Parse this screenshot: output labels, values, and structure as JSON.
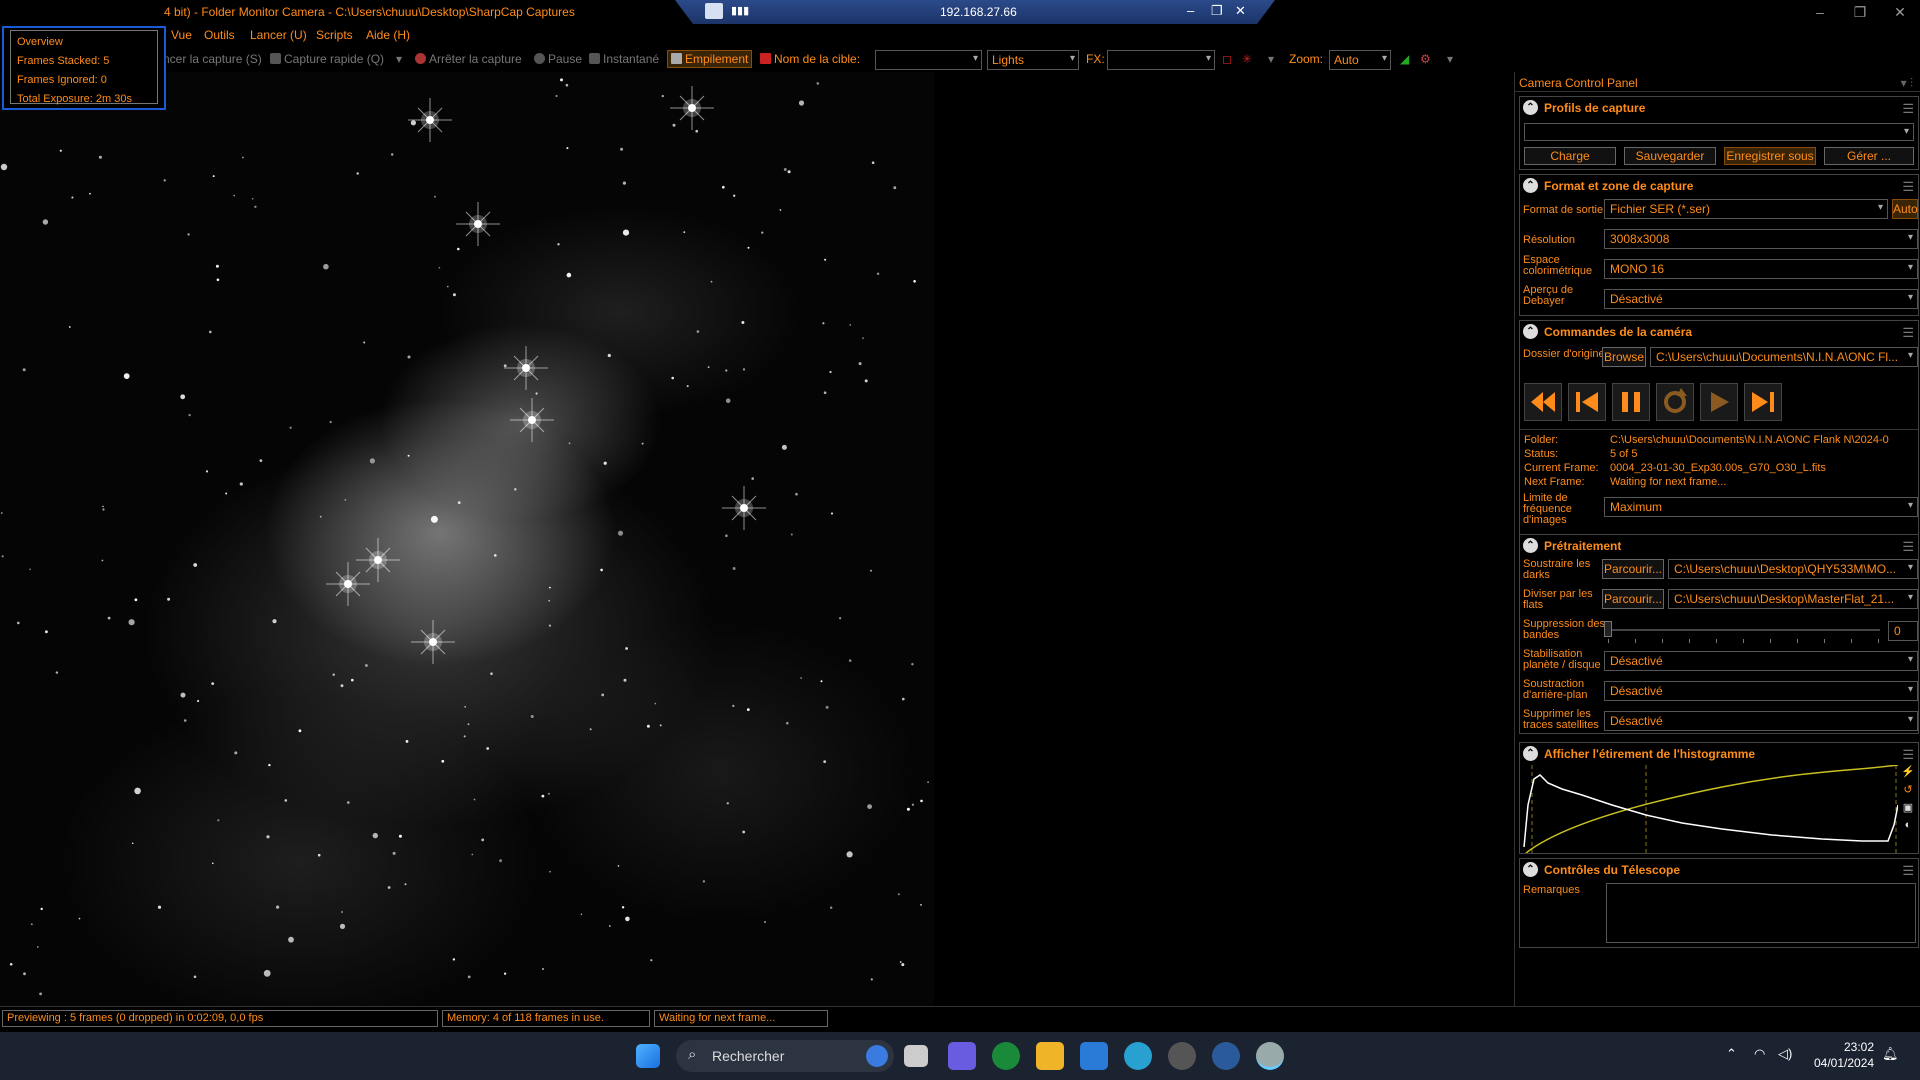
{
  "window": {
    "title": "4 bit) - Folder Monitor Camera - C:\\Users\\chuuu\\Desktop\\SharpCap Captures",
    "remote_ip": "192.168.27.66"
  },
  "menu": [
    "Vue",
    "Outils",
    "Lancer (U)",
    "Scripts",
    "Aide (H)"
  ],
  "toolbar": {
    "start_capture": "ncer la capture (S)",
    "quick_capture": "Capture rapide (Q)",
    "stop_capture": "Arrêter la capture",
    "pause": "Pause",
    "snapshot": "Instantané",
    "stacking": "Empilement",
    "target_name_label": "Nom de la cible:",
    "target_name_value": "",
    "frame_type": "Lights",
    "fx_label": "FX:",
    "fx_value": "",
    "zoom_label": "Zoom:",
    "zoom_value": "Auto"
  },
  "overview": {
    "title": "Overview",
    "frames_stacked": "Frames Stacked: 5",
    "frames_ignored": "Frames Ignored: 0",
    "total_exposure": "Total Exposure:   2m 30s"
  },
  "panel": {
    "title": "Camera Control Panel",
    "profiles": {
      "title": "Profils de capture",
      "selected": "",
      "load": "Charge",
      "save": "Sauvegarder",
      "save_as": "Enregistrer sous",
      "manage": "Gérer ..."
    },
    "format": {
      "title": "Format et zone de capture",
      "output_label": "Format de sortie",
      "output_value": "Fichier SER (*.ser)",
      "auto": "Auto",
      "resolution_label": "Résolution",
      "resolution_value": "3008x3008",
      "colorspace_label": "Espace colorimétrique",
      "colorspace_value": "MONO 16",
      "debayer_label": "Aperçu de Debayer",
      "debayer_value": "Désactivé"
    },
    "camera": {
      "title": "Commandes de la caméra",
      "source_label": "Dossier d'origine",
      "browse": "Browse",
      "source_value": "C:\\Users\\chuuu\\Documents\\N.I.N.A\\ONC Fl...",
      "folder_label": "Folder:",
      "folder_value": "C:\\Users\\chuuu\\Documents\\N.I.N.A\\ONC Flank N\\2024-0",
      "status_label": "Status:",
      "status_value": "5 of 5",
      "current_label": "Current Frame:",
      "current_value": "0004_23-01-30_Exp30.00s_G70_O30_L.fits",
      "next_label": "Next Frame:",
      "next_value": "Waiting for next frame...",
      "rate_label": "Limite de fréquence d'images",
      "rate_value": "Maximum"
    },
    "preprocessing": {
      "title": "Prétraitement",
      "darks_label": "Soustraire les darks",
      "darks_browse": "Parcourir...",
      "darks_value": "C:\\Users\\chuuu\\Desktop\\QHY533M\\MO...",
      "flats_label": "Diviser par les flats",
      "flats_browse": "Parcourir...",
      "flats_value": "C:\\Users\\chuuu\\Desktop\\MasterFlat_21...",
      "banding_label": "Suppression des bandes",
      "banding_value": "0",
      "stabilization_label": "Stabilisation planète / disque",
      "stabilization_value": "Désactivé",
      "background_label": "Soustraction d'arrière-plan",
      "background_value": "Désactivé",
      "satellite_label": "Supprimer les traces satellites",
      "satellite_value": "Désactivé"
    },
    "histogram": {
      "title": "Afficher l'étirement de l'histogramme"
    },
    "telescope": {
      "title": "Contrôles du Télescope",
      "notes_label": "Remarques",
      "notes_value": ""
    }
  },
  "status": {
    "previewing": "Previewing : 5 frames (0 dropped) in 0:02:09, 0,0 fps",
    "memory": "Memory: 4 of 118 frames in use.",
    "waiting": "Waiting for next frame..."
  },
  "taskbar": {
    "search": "Rechercher",
    "time": "23:02",
    "date": "04/01/2024"
  },
  "colors": {
    "accent": "#ff8c1a",
    "taskbar": "#1b2230",
    "remote_bar": "#2b4a8a"
  }
}
